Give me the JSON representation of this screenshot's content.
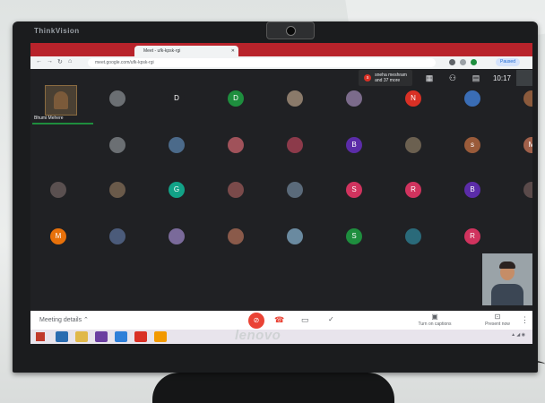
{
  "monitor": {
    "brand": "ThinkVision",
    "logo": "lenovo"
  },
  "browser": {
    "tabs": [
      {
        "label": "",
        "active": false
      },
      {
        "label": "Meet - ufk-kpsk-rgi",
        "active": true
      },
      {
        "label": "",
        "active": false
      }
    ],
    "url": "meet.google.com/ufk-kpsk-rgi",
    "profile_label": "Paused"
  },
  "meet": {
    "presenter_text_line1": "sneha meshram",
    "presenter_text_line2": "and 37 more",
    "clock": "10:17",
    "speaker_name": "Bhumi Mehere",
    "grid": [
      [
        {
          "t": "",
          "c": "#6b6f73"
        },
        {
          "t": "D",
          "c": "#202124"
        },
        {
          "t": "D",
          "c": "#1e8e3e"
        },
        {
          "t": "",
          "c": "#8a7a6a"
        },
        {
          "t": "",
          "c": "#7b6b8b"
        },
        {
          "t": "N",
          "c": "#d93025"
        },
        {
          "t": "",
          "c": "#3a6db5"
        },
        {
          "t": "",
          "c": "#8b5a3c"
        }
      ],
      [
        {
          "t": "",
          "c": "#6b6f73"
        },
        {
          "t": "",
          "c": "#4b6a8a"
        },
        {
          "t": "",
          "c": "#a0525a"
        },
        {
          "t": "",
          "c": "#8c3a4a"
        },
        {
          "t": "B",
          "c": "#5b2ca8"
        },
        {
          "t": "",
          "c": "#6b6050"
        },
        {
          "t": "s",
          "c": "#9a5b3a"
        },
        {
          "t": "M",
          "c": "#a0604a"
        },
        {
          "t": "",
          "c": "#4a4a4a"
        }
      ],
      [
        {
          "t": "",
          "c": "#5a5050"
        },
        {
          "t": "",
          "c": "#6a5a4a"
        },
        {
          "t": "G",
          "c": "#12a287"
        },
        {
          "t": "",
          "c": "#7a4a4a"
        },
        {
          "t": "",
          "c": "#5a6a7a"
        },
        {
          "t": "S",
          "c": "#d0335e"
        },
        {
          "t": "R",
          "c": "#d0335e"
        },
        {
          "t": "B",
          "c": "#5b2ca8"
        },
        {
          "t": "",
          "c": "#5a4a4a"
        }
      ],
      [
        {
          "t": "M",
          "c": "#e8710a"
        },
        {
          "t": "",
          "c": "#4b5b7a"
        },
        {
          "t": "",
          "c": "#7a6a9a"
        },
        {
          "t": "",
          "c": "#8a5a4a"
        },
        {
          "t": "",
          "c": "#6a8aa0"
        },
        {
          "t": "S",
          "c": "#1e8e3e"
        },
        {
          "t": "",
          "c": "#2a6a7a"
        },
        {
          "t": "R",
          "c": "#d0335e"
        }
      ]
    ],
    "meeting_details": "Meeting details",
    "turn_on_captions": "Turn on captions",
    "present_now": "Present now"
  }
}
